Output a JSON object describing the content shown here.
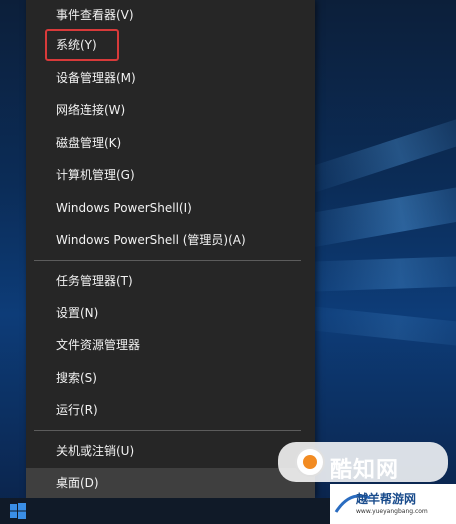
{
  "context_menu": {
    "items": [
      {
        "label": "事件查看器(V)"
      },
      {
        "label": "系统(Y)"
      },
      {
        "label": "设备管理器(M)"
      },
      {
        "label": "网络连接(W)"
      },
      {
        "label": "磁盘管理(K)"
      },
      {
        "label": "计算机管理(G)"
      },
      {
        "label": "Windows PowerShell(I)"
      },
      {
        "label": "Windows PowerShell (管理员)(A)"
      },
      {
        "label": "任务管理器(T)"
      },
      {
        "label": "设置(N)"
      },
      {
        "label": "文件资源管理器"
      },
      {
        "label": "搜索(S)"
      },
      {
        "label": "运行(R)"
      },
      {
        "label": "关机或注销(U)"
      },
      {
        "label": "桌面(D)"
      }
    ],
    "highlighted_item": "系统(Y)",
    "highlight_color": "#d83a3a",
    "background_color": "#262626"
  },
  "watermark": {
    "brand_text": "酷知网",
    "secondary_text": "越羊帮游网",
    "url": "www.yueyangbang.com"
  },
  "taskbar": {
    "start_icon": "windows-logo-icon"
  }
}
